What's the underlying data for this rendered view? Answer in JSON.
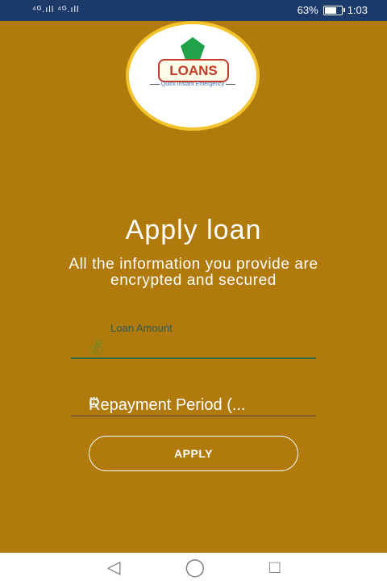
{
  "status_bar": {
    "signal": "⁴ᴳ.ıll ⁴ᴳ.ıll",
    "battery": "63%",
    "battery_level": 0.63,
    "time": "1:03"
  },
  "logo": {
    "text": "LOANS",
    "tagline": "Quick Instant Emergency"
  },
  "title": "Apply loan",
  "subtitle": "All the information you provide are encrypted and secured",
  "loan_amount": {
    "label": "Loan Amount",
    "value": ""
  },
  "repayment_period": {
    "placeholder": "Repayment Period (..."
  },
  "apply_button": "APPLY",
  "colors": {
    "background": "#b07a0c",
    "status_bar": "#1c3b6b",
    "logo_green": "#1fa24a",
    "logo_red": "#c33a2a"
  }
}
